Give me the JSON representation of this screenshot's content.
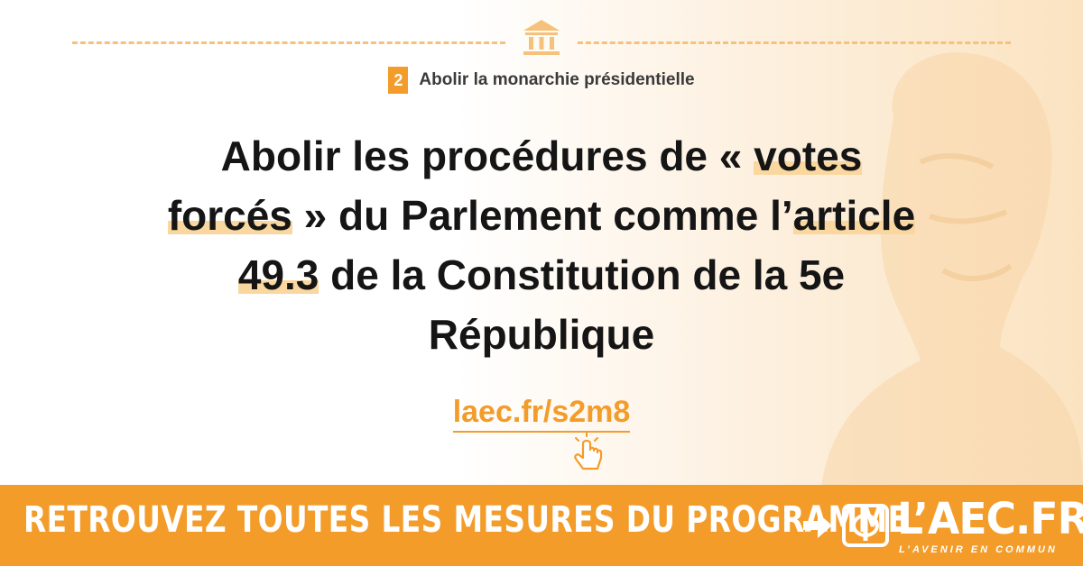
{
  "category": {
    "number": "2",
    "label": "Abolir la monarchie présidentielle"
  },
  "headline": {
    "lines": [
      [
        {
          "text": "Abolir les procédures de « "
        },
        {
          "text": "votes",
          "hl": true
        }
      ],
      [
        {
          "text": "forcés",
          "hl": true
        },
        {
          "text": " » du Parlement comme l’"
        },
        {
          "text": "article",
          "hl": true
        }
      ],
      [
        {
          "text": "49.3",
          "hl": true
        },
        {
          "text": " de la Constitution de la 5e"
        }
      ],
      [
        {
          "text": "République"
        }
      ]
    ]
  },
  "link": {
    "text": "laec.fr/s2m8"
  },
  "banner": {
    "text": "RETROUVEZ TOUTES LES MESURES DU PROGRAMME",
    "logo_text": "L’AEC.FR",
    "logo_tagline": "L’AVENIR EN COMMUN"
  },
  "colors": {
    "accent": "#f39c2a",
    "highlight": "#fad79f",
    "text": "#151515"
  },
  "icons": [
    "building-icon",
    "hand-pointer-icon",
    "arrow-right-icon",
    "phi-logo-icon"
  ]
}
